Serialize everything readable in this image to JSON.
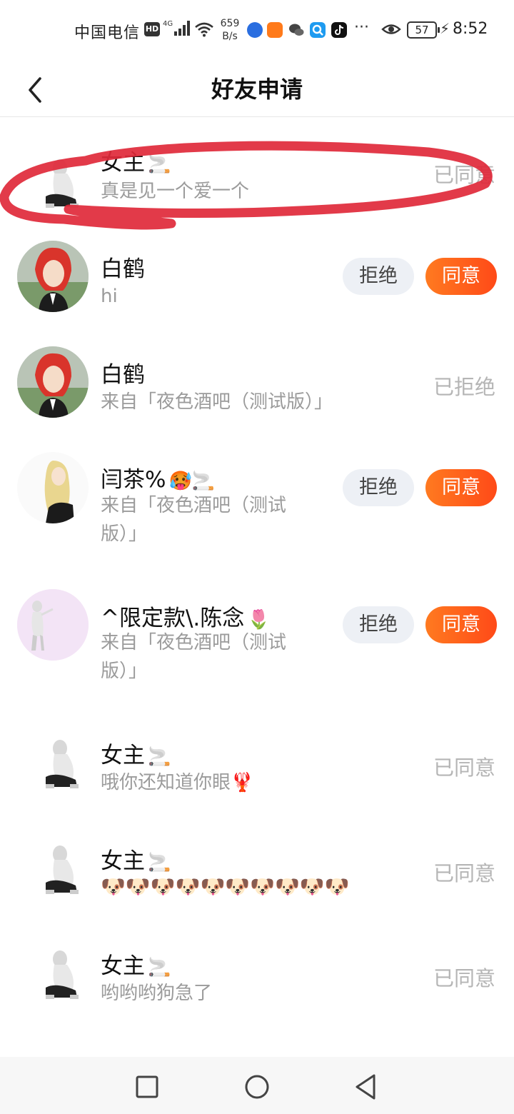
{
  "status_bar": {
    "carrier": "中国电信",
    "hd": "HD",
    "network": "4G",
    "speed_value": "659",
    "speed_unit": "B/s",
    "more": "···",
    "battery": "57",
    "time": "8:52"
  },
  "header": {
    "title": "好友申请"
  },
  "requests": [
    {
      "name": "女主",
      "name_emoji": "🚬",
      "message": "真是见一个爱一个",
      "status": "已同意"
    },
    {
      "name": "白鹤",
      "name_emoji": "",
      "message": "hi",
      "reject_label": "拒绝",
      "agree_label": "同意"
    },
    {
      "name": "白鹤",
      "name_emoji": "",
      "message": "来自「夜色酒吧（测试版）」",
      "status": "已拒绝"
    },
    {
      "name": "闫茶%",
      "name_emoji": "🥵🚬",
      "message": "来自「夜色酒吧（测试版）」",
      "reject_label": "拒绝",
      "agree_label": "同意"
    },
    {
      "name": "^限定款\\.陈念",
      "name_emoji": "🌷",
      "message": "来自「夜色酒吧（测试版）」",
      "reject_label": "拒绝",
      "agree_label": "同意"
    },
    {
      "name": "女主",
      "name_emoji": "🚬",
      "message": "哦你还知道你眼🦞",
      "status": "已同意"
    },
    {
      "name": "女主",
      "name_emoji": "🚬",
      "message": "🐶🐶🐶🐶🐶🐶🐶🐶🐶🐶",
      "status": "已同意"
    },
    {
      "name": "女主",
      "name_emoji": "🚬",
      "message": "哟哟哟狗急了",
      "status": "已同意"
    }
  ],
  "colors": {
    "accent": "#ff5a1f",
    "reject_bg": "#edf0f5",
    "muted": "#9b9b9b",
    "annotation": "#e0293a"
  }
}
